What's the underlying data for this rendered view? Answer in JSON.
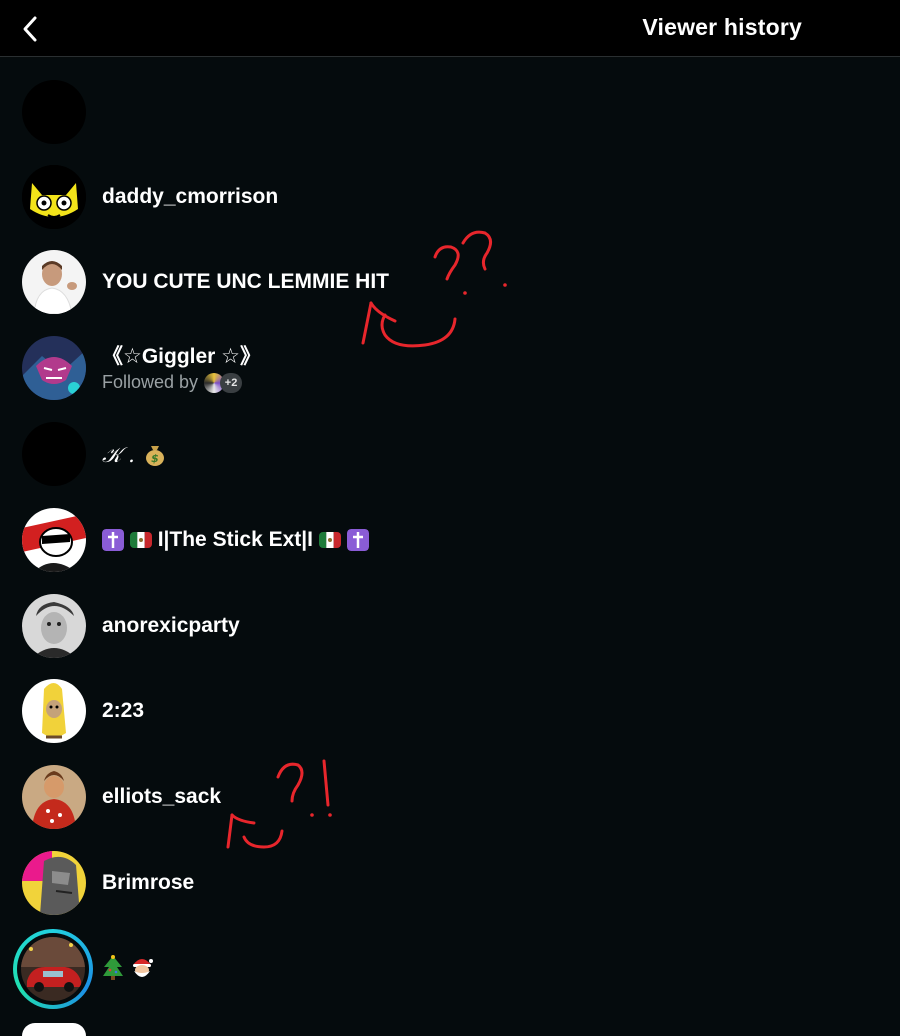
{
  "header": {
    "title": "Viewer history",
    "back_icon": "chevron-left-icon"
  },
  "viewers": [
    {
      "name": ""
    },
    {
      "name": "daddy_cmorrison"
    },
    {
      "name": "YOU CUTE UNC LEMMIE HIT"
    },
    {
      "name": "《☆Giggler ☆》",
      "followed_by": "Followed by",
      "followed_count": "+2"
    },
    {
      "name": "𝒦 ."
    },
    {
      "name": "I|The Stick Ext|I"
    },
    {
      "name": "anorexicparty"
    },
    {
      "name": "2:23"
    },
    {
      "name": "elliots_sack"
    },
    {
      "name": "Brimrose"
    },
    {
      "name": ""
    }
  ],
  "annotations": {
    "color": "#e8262c",
    "marks": [
      "??",
      "?!"
    ]
  },
  "colors": {
    "background": "#050b0d",
    "header_bg": "#000000",
    "text_primary": "#ffffff",
    "text_secondary": "#9aa1a4",
    "story_ring": "#22d1e0"
  }
}
